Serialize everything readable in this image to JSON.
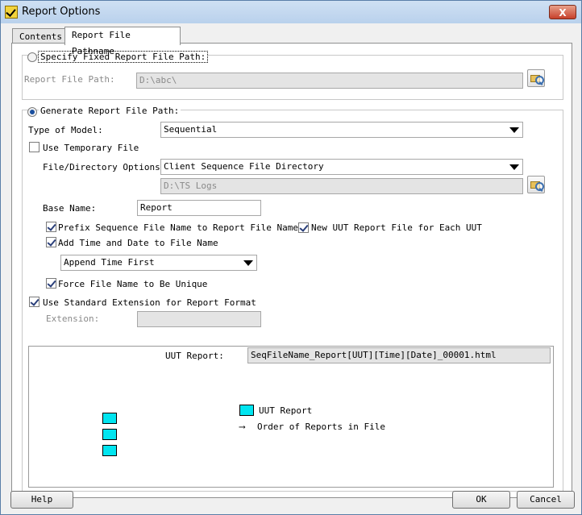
{
  "window": {
    "title": "Report Options",
    "close_label": "X"
  },
  "tabs": [
    {
      "label": "Contents"
    },
    {
      "label": "Report File Pathname"
    }
  ],
  "fixed": {
    "radio_label": "Specify Fixed Report File Path:",
    "path_label": "Report File Path:",
    "path_value": "D:\\abc\\"
  },
  "generate": {
    "radio_label": "Generate Report File Path:",
    "model_label": "Type of Model:",
    "model_value": "Sequential",
    "use_temp_label": "Use Temporary File",
    "dir_options_label": "File/Directory Options:",
    "dir_options_value": "Client Sequence File Directory",
    "dir_path_value": "D:\\TS Logs",
    "base_name_label": "Base Name:",
    "base_name_value": "Report",
    "prefix_label": "Prefix Sequence File Name to Report File Name",
    "new_uut_label": "New UUT Report File for Each UUT",
    "add_time_label": "Add Time and Date to File Name",
    "time_order_value": "Append Time First",
    "force_unique_label": "Force File Name to Be Unique",
    "use_std_ext_label": "Use Standard Extension for Report Format",
    "extension_label": "Extension:",
    "extension_value": ""
  },
  "preview": {
    "uut_report_label": "UUT Report:",
    "uut_report_value": "SeqFileName_Report[UUT][Time][Date]_00001.html",
    "legend_uut": "UUT Report",
    "legend_order": "Order of Reports in File",
    "swatch_color": "#00e5f0"
  },
  "buttons": {
    "help": "Help",
    "ok": "OK",
    "cancel": "Cancel"
  }
}
